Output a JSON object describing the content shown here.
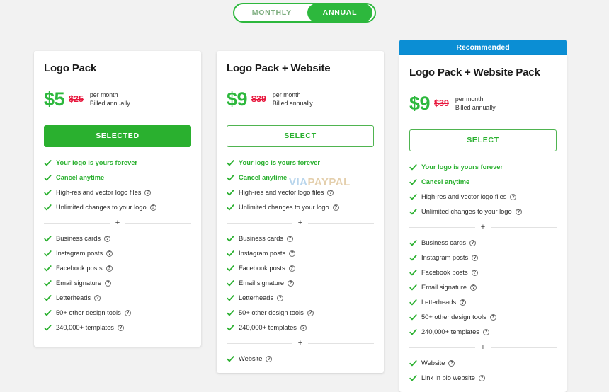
{
  "billing_toggle": {
    "options": [
      {
        "label": "MONTHLY",
        "active": false
      },
      {
        "label": "ANNUAL",
        "active": true
      }
    ]
  },
  "watermark": {
    "part1": "VIA",
    "part2": "PAYPAL"
  },
  "icons": {
    "check": "check-icon",
    "help": "help-circle-icon",
    "plus": "+"
  },
  "colors": {
    "green": "#2ab02f",
    "green_toggle": "#2db83d",
    "red_strike": "#e8173d",
    "blue_ribbon": "#0b8ed4",
    "page_bg": "#f2f2f2",
    "card_bg": "#ffffff"
  },
  "plans": [
    {
      "ribbon": null,
      "title": "Logo Pack",
      "price_now": "$5",
      "price_was": "$25",
      "price_note_line1": "per month",
      "price_note_line2": "Billed annually",
      "button": {
        "label": "SELECTED",
        "style": "filled"
      },
      "group1": [
        {
          "label": "Your logo is yours forever",
          "highlight": true,
          "help": false
        },
        {
          "label": "Cancel anytime",
          "highlight": true,
          "help": false
        },
        {
          "label": "High-res and vector logo files",
          "highlight": false,
          "help": true
        },
        {
          "label": "Unlimited changes to your logo",
          "highlight": false,
          "help": true
        }
      ],
      "group2": [
        {
          "label": "Business cards",
          "highlight": false,
          "help": true
        },
        {
          "label": "Instagram posts",
          "highlight": false,
          "help": true
        },
        {
          "label": "Facebook posts",
          "highlight": false,
          "help": true
        },
        {
          "label": "Email signature",
          "highlight": false,
          "help": true
        },
        {
          "label": "Letterheads",
          "highlight": false,
          "help": true
        },
        {
          "label": "50+ other design tools",
          "highlight": false,
          "help": true
        },
        {
          "label": "240,000+ templates",
          "highlight": false,
          "help": true
        }
      ],
      "group3": []
    },
    {
      "ribbon": null,
      "title": "Logo Pack + Website",
      "price_now": "$9",
      "price_was": "$39",
      "price_note_line1": "per month",
      "price_note_line2": "Billed annually",
      "button": {
        "label": "SELECT",
        "style": "outline"
      },
      "group1": [
        {
          "label": "Your logo is yours forever",
          "highlight": true,
          "help": false
        },
        {
          "label": "Cancel anytime",
          "highlight": true,
          "help": false
        },
        {
          "label": "High-res and vector logo files",
          "highlight": false,
          "help": true
        },
        {
          "label": "Unlimited changes to your logo",
          "highlight": false,
          "help": true
        }
      ],
      "group2": [
        {
          "label": "Business cards",
          "highlight": false,
          "help": true
        },
        {
          "label": "Instagram posts",
          "highlight": false,
          "help": true
        },
        {
          "label": "Facebook posts",
          "highlight": false,
          "help": true
        },
        {
          "label": "Email signature",
          "highlight": false,
          "help": true
        },
        {
          "label": "Letterheads",
          "highlight": false,
          "help": true
        },
        {
          "label": "50+ other design tools",
          "highlight": false,
          "help": true
        },
        {
          "label": "240,000+ templates",
          "highlight": false,
          "help": true
        }
      ],
      "group3": [
        {
          "label": "Website",
          "highlight": false,
          "help": true
        }
      ]
    },
    {
      "ribbon": "Recommended",
      "title": "Logo Pack + Website Pack",
      "price_now": "$9",
      "price_was": "$39",
      "price_note_line1": "per month",
      "price_note_line2": "Billed annually",
      "button": {
        "label": "SELECT",
        "style": "outline"
      },
      "group1": [
        {
          "label": "Your logo is yours forever",
          "highlight": true,
          "help": false
        },
        {
          "label": "Cancel anytime",
          "highlight": true,
          "help": false
        },
        {
          "label": "High-res and vector logo files",
          "highlight": false,
          "help": true
        },
        {
          "label": "Unlimited changes to your logo",
          "highlight": false,
          "help": true
        }
      ],
      "group2": [
        {
          "label": "Business cards",
          "highlight": false,
          "help": true
        },
        {
          "label": "Instagram posts",
          "highlight": false,
          "help": true
        },
        {
          "label": "Facebook posts",
          "highlight": false,
          "help": true
        },
        {
          "label": "Email signature",
          "highlight": false,
          "help": true
        },
        {
          "label": "Letterheads",
          "highlight": false,
          "help": true
        },
        {
          "label": "50+ other design tools",
          "highlight": false,
          "help": true
        },
        {
          "label": "240,000+ templates",
          "highlight": false,
          "help": true
        }
      ],
      "group3": [
        {
          "label": "Website",
          "highlight": false,
          "help": true
        },
        {
          "label": "Link in bio website",
          "highlight": false,
          "help": true
        }
      ]
    }
  ]
}
